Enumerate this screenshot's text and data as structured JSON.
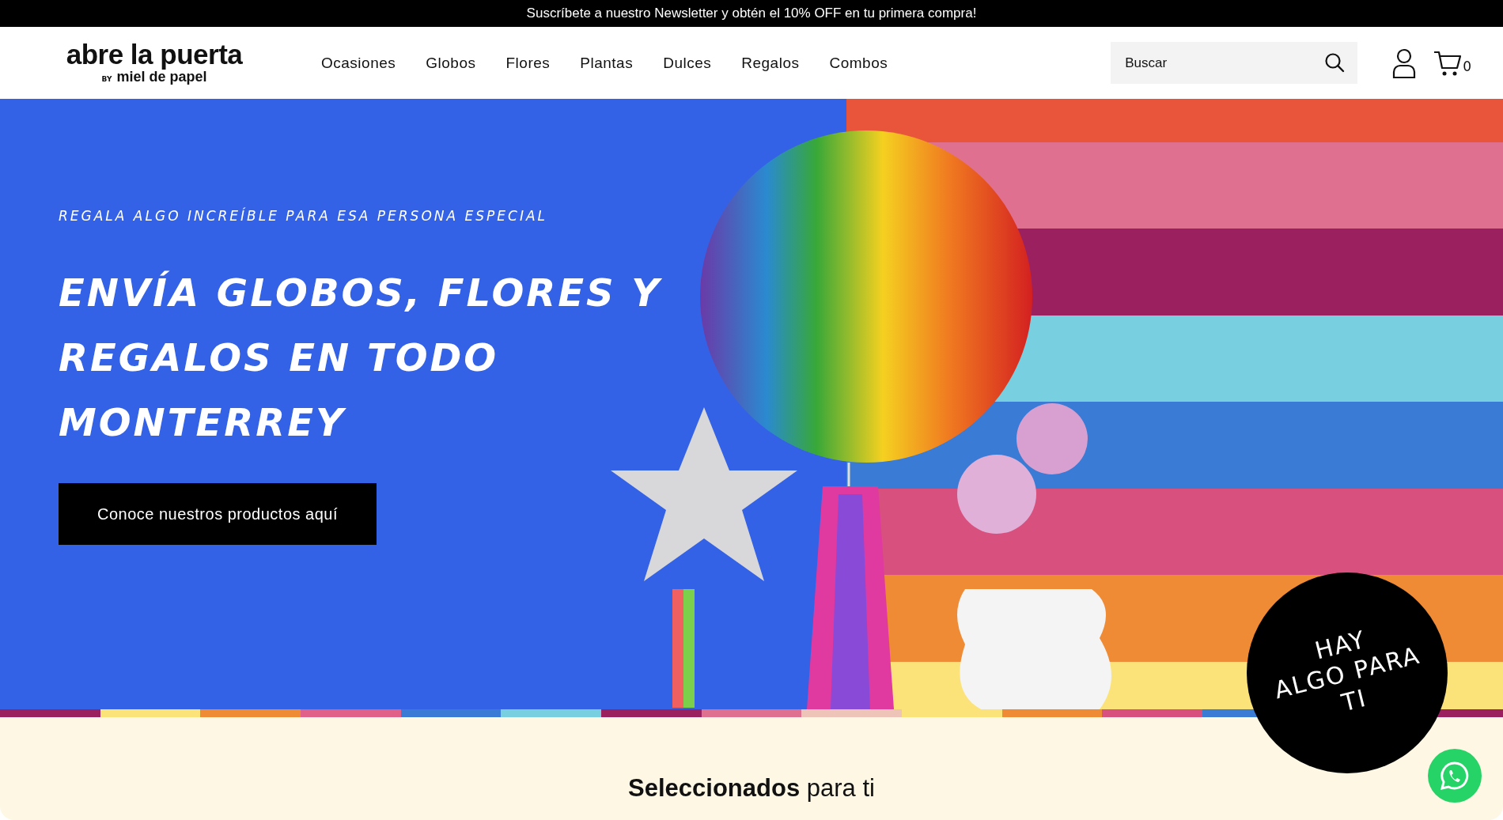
{
  "announcement": "Suscríbete a nuestro Newsletter y obtén el 10% OFF en tu primera compra!",
  "logo": {
    "name": "abre la puerta",
    "by": "BY",
    "sub": "miel de papel"
  },
  "nav": [
    "Ocasiones",
    "Globos",
    "Flores",
    "Plantas",
    "Dulces",
    "Regalos",
    "Combos"
  ],
  "search": {
    "placeholder": "Buscar"
  },
  "cart": {
    "count": "0"
  },
  "hero": {
    "eyebrow": "REGALA ALGO INCREÍBLE PARA ESA PERSONA ESPECIAL",
    "headline": "ENVÍA GLOBOS, FLORES Y REGALOS EN TODO MONTERREY",
    "button": "Conoce nuestros productos aquí"
  },
  "badge": {
    "lines": [
      "HAY",
      "ALGO PARA",
      "TI"
    ]
  },
  "section": {
    "title": "**Seleccionados** para ti"
  }
}
